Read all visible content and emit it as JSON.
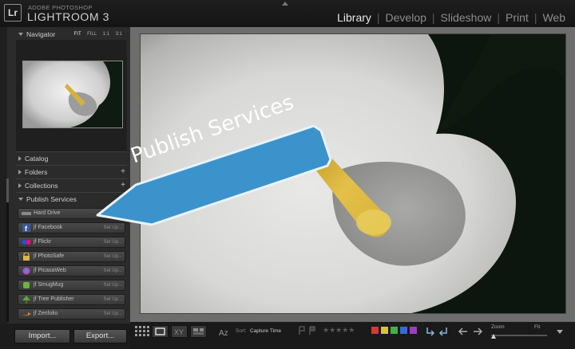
{
  "app": {
    "logo": "Lr",
    "brand_top": "ADOBE PHOTOSHOP",
    "brand_main": "LIGHTROOM 3"
  },
  "modules": [
    {
      "label": "Library",
      "active": true
    },
    {
      "label": "Develop",
      "active": false
    },
    {
      "label": "Slideshow",
      "active": false
    },
    {
      "label": "Print",
      "active": false
    },
    {
      "label": "Web",
      "active": false
    }
  ],
  "navigator": {
    "title": "Navigator",
    "modes": [
      "FIT",
      "FILL",
      "1:1",
      "3:1"
    ]
  },
  "panels": {
    "catalog": "Catalog",
    "folders": "Folders",
    "collections": "Collections",
    "publish_services": "Publish Services"
  },
  "services": [
    {
      "name": "Hard Drive",
      "setup": "",
      "icon": "hard-drive-icon"
    },
    {
      "name": "jf Facebook",
      "setup": "Set Up...",
      "icon": "facebook-icon"
    },
    {
      "name": "jf Flickr",
      "setup": "Set Up...",
      "icon": "flickr-icon"
    },
    {
      "name": "jf PhotoSafe",
      "setup": "Set Up...",
      "icon": "lock-icon"
    },
    {
      "name": "jf PicasaWeb",
      "setup": "Set Up...",
      "icon": "picasa-icon"
    },
    {
      "name": "jf SmugMug",
      "setup": "Set Up...",
      "icon": "smugmug-icon"
    },
    {
      "name": "jf Tree Publisher",
      "setup": "Set Up...",
      "icon": "tree-icon"
    },
    {
      "name": "jf Zenfolio",
      "setup": "Set Up...",
      "icon": "zenfolio-icon"
    }
  ],
  "buttons": {
    "import": "Import...",
    "export": "Export..."
  },
  "callout": "Publish Services",
  "toolbar": {
    "sort_label": "Sort:",
    "sort_value": "Capture Time",
    "stars": "★★★★★",
    "zoom_label": "Zoom",
    "fit_label": "Fit",
    "color_labels": [
      "#d23a3a",
      "#d6c531",
      "#3fb33f",
      "#3a6ad6",
      "#9a3fc0"
    ]
  }
}
